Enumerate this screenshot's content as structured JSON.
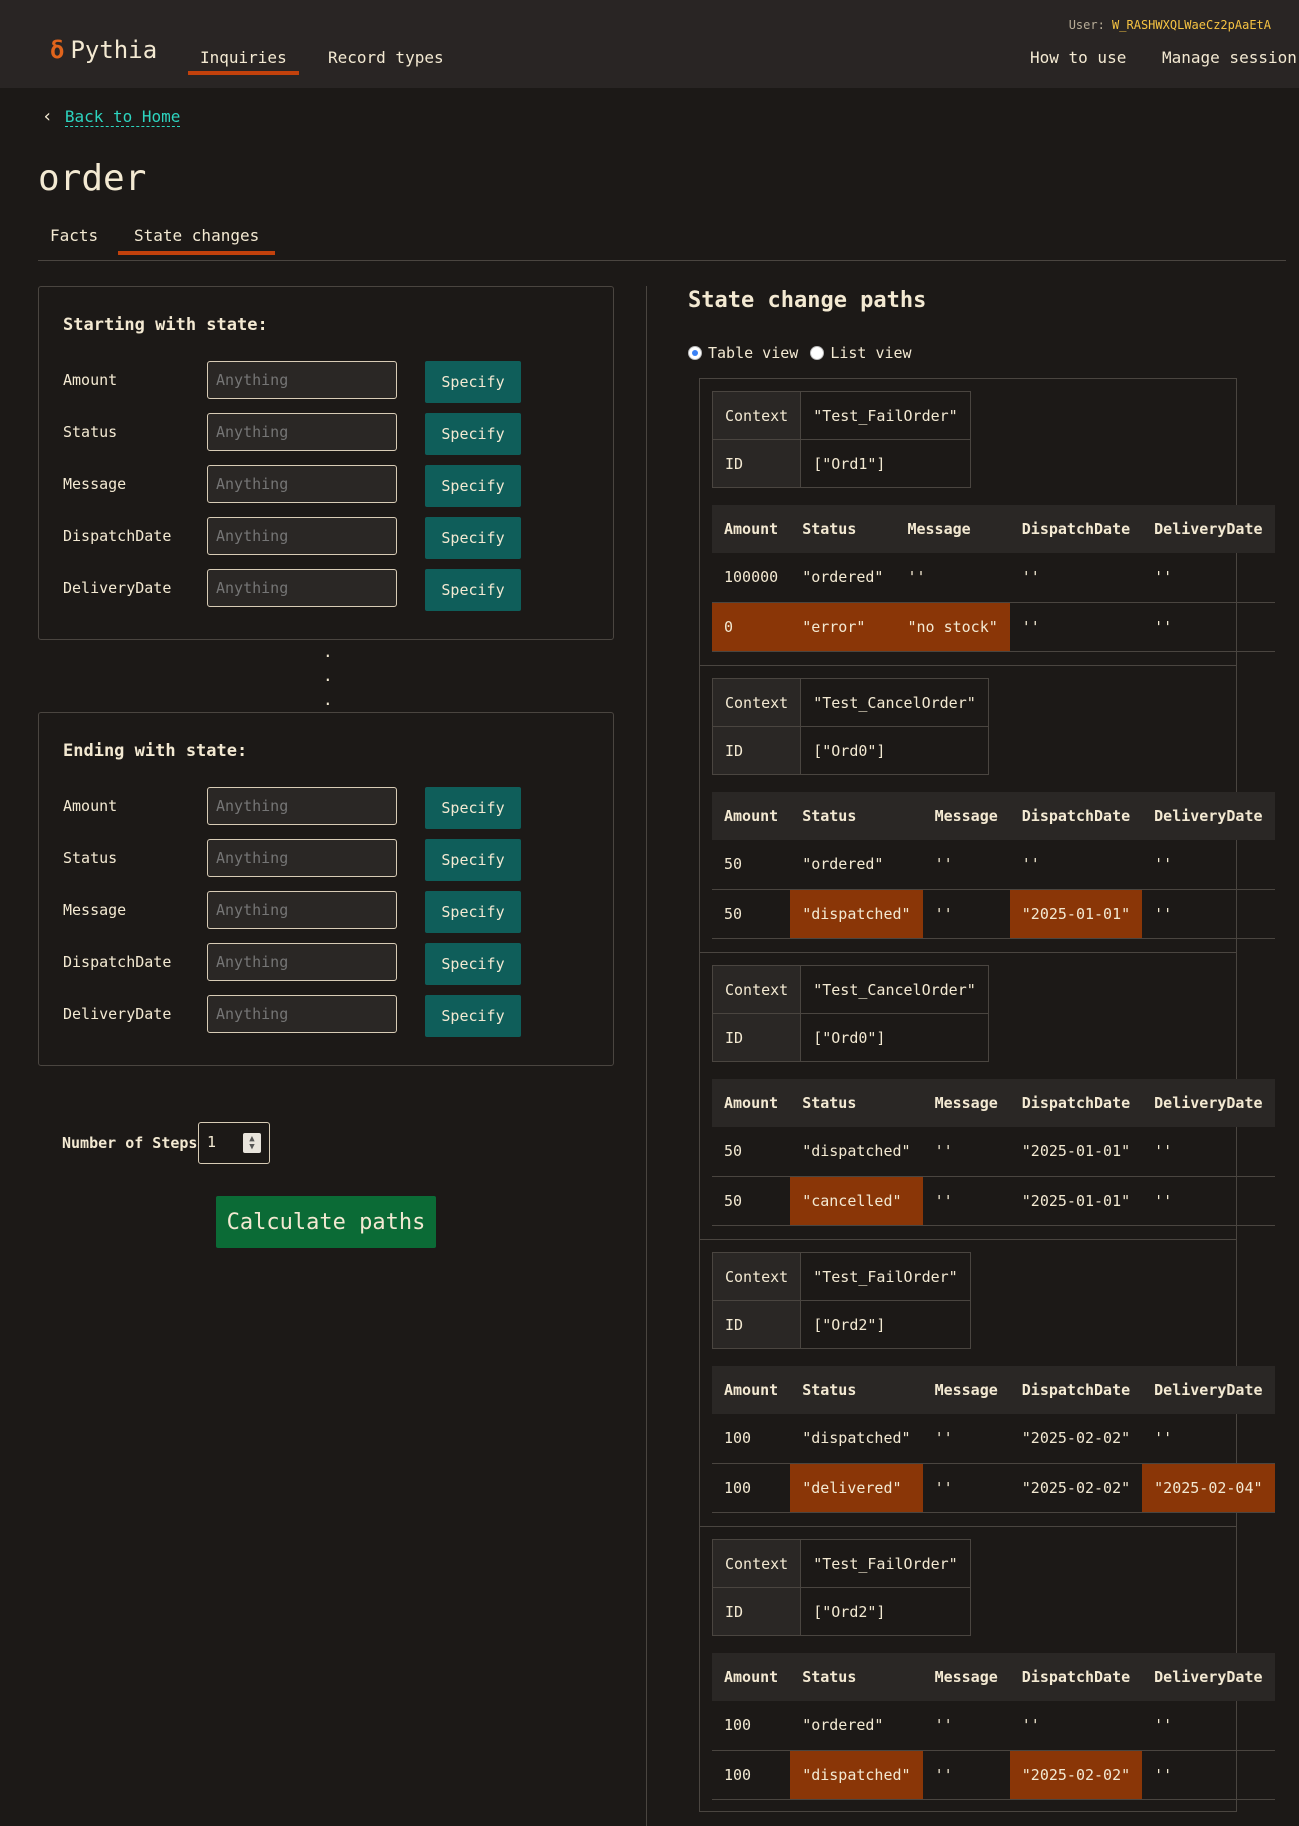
{
  "header": {
    "logo_text": "Pythia",
    "nav": [
      {
        "label": "Inquiries",
        "active": true
      },
      {
        "label": "Record types",
        "active": false
      }
    ],
    "user_label": "User:",
    "user_id": "W_RASHWXQLWaeCz2pAaEtA",
    "right_nav": [
      "How to use",
      "Manage session"
    ]
  },
  "page": {
    "back_label": "Back to Home",
    "title": "order",
    "tabs": [
      {
        "label": "Facts",
        "active": false
      },
      {
        "label": "State changes",
        "active": true
      }
    ]
  },
  "starting": {
    "title": "Starting with state:",
    "fields": [
      {
        "label": "Amount",
        "placeholder": "Anything",
        "button": "Specify"
      },
      {
        "label": "Status",
        "placeholder": "Anything",
        "button": "Specify"
      },
      {
        "label": "Message",
        "placeholder": "Anything",
        "button": "Specify"
      },
      {
        "label": "DispatchDate",
        "placeholder": "Anything",
        "button": "Specify"
      },
      {
        "label": "DeliveryDate",
        "placeholder": "Anything",
        "button": "Specify"
      }
    ]
  },
  "ending": {
    "title": "Ending with state:",
    "fields": [
      {
        "label": "Amount",
        "placeholder": "Anything",
        "button": "Specify"
      },
      {
        "label": "Status",
        "placeholder": "Anything",
        "button": "Specify"
      },
      {
        "label": "Message",
        "placeholder": "Anything",
        "button": "Specify"
      },
      {
        "label": "DispatchDate",
        "placeholder": "Anything",
        "button": "Specify"
      },
      {
        "label": "DeliveryDate",
        "placeholder": "Anything",
        "button": "Specify"
      }
    ]
  },
  "steps": {
    "label": "Number of Steps:",
    "value": "1"
  },
  "calculate_label": "Calculate paths",
  "results": {
    "title": "State change paths",
    "view_options": [
      {
        "label": "Table view",
        "selected": true
      },
      {
        "label": "List view",
        "selected": false
      }
    ],
    "columns": [
      "Amount",
      "Status",
      "Message",
      "DispatchDate",
      "DeliveryDate"
    ],
    "context_label": "Context",
    "id_label": "ID",
    "highlight_color": "#8a3607",
    "paths": [
      {
        "context": "\"Test_FailOrder\"",
        "id": "[\"Ord1\"]",
        "rows": [
          {
            "cells": [
              "100000",
              "\"ordered\"",
              "''",
              "''",
              "''"
            ],
            "highlight": [
              false,
              false,
              false,
              false,
              false
            ]
          },
          {
            "cells": [
              "0",
              "\"error\"",
              "\"no stock\"",
              "''",
              "''"
            ],
            "highlight": [
              true,
              true,
              true,
              false,
              false
            ]
          }
        ]
      },
      {
        "context": "\"Test_CancelOrder\"",
        "id": "[\"Ord0\"]",
        "rows": [
          {
            "cells": [
              "50",
              "\"ordered\"",
              "''",
              "''",
              "''"
            ],
            "highlight": [
              false,
              false,
              false,
              false,
              false
            ]
          },
          {
            "cells": [
              "50",
              "\"dispatched\"",
              "''",
              "\"2025-01-01\"",
              "''"
            ],
            "highlight": [
              false,
              true,
              false,
              true,
              false
            ]
          }
        ]
      },
      {
        "context": "\"Test_CancelOrder\"",
        "id": "[\"Ord0\"]",
        "rows": [
          {
            "cells": [
              "50",
              "\"dispatched\"",
              "''",
              "\"2025-01-01\"",
              "''"
            ],
            "highlight": [
              false,
              false,
              false,
              false,
              false
            ]
          },
          {
            "cells": [
              "50",
              "\"cancelled\"",
              "''",
              "\"2025-01-01\"",
              "''"
            ],
            "highlight": [
              false,
              true,
              false,
              false,
              false
            ]
          }
        ]
      },
      {
        "context": "\"Test_FailOrder\"",
        "id": "[\"Ord2\"]",
        "rows": [
          {
            "cells": [
              "100",
              "\"dispatched\"",
              "''",
              "\"2025-02-02\"",
              "''"
            ],
            "highlight": [
              false,
              false,
              false,
              false,
              false
            ]
          },
          {
            "cells": [
              "100",
              "\"delivered\"",
              "''",
              "\"2025-02-02\"",
              "\"2025-02-04\""
            ],
            "highlight": [
              false,
              true,
              false,
              false,
              true
            ]
          }
        ]
      },
      {
        "context": "\"Test_FailOrder\"",
        "id": "[\"Ord2\"]",
        "rows": [
          {
            "cells": [
              "100",
              "\"ordered\"",
              "''",
              "''",
              "''"
            ],
            "highlight": [
              false,
              false,
              false,
              false,
              false
            ]
          },
          {
            "cells": [
              "100",
              "\"dispatched\"",
              "''",
              "\"2025-02-02\"",
              "''"
            ],
            "highlight": [
              false,
              true,
              false,
              true,
              false
            ]
          }
        ]
      }
    ]
  }
}
